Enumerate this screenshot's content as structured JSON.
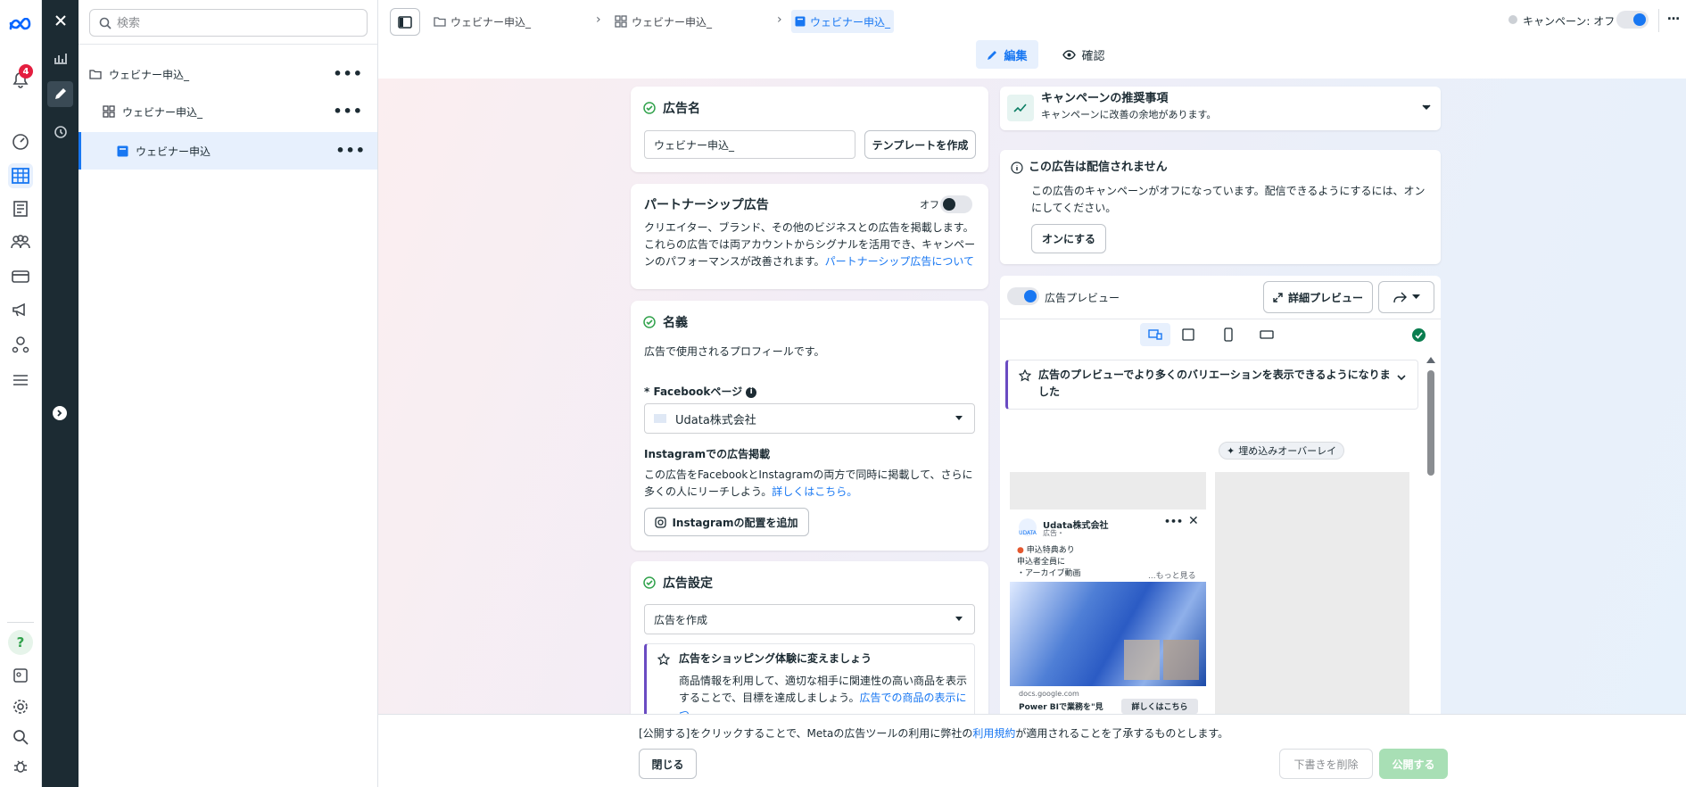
{
  "rail": {
    "notif_count": "4"
  },
  "tree": {
    "search_placeholder": "検索",
    "items": [
      {
        "label": "ウェビナー申込_"
      },
      {
        "label": "ウェビナー申込_"
      },
      {
        "label": "ウェビナー申込"
      }
    ]
  },
  "breadcrumb": {
    "campaign": "ウェビナー申込_",
    "adset": "ウェビナー申込_",
    "ad": "ウェビナー申込_"
  },
  "header": {
    "campaign_status": "キャンペーン: オフ",
    "tab_edit": "編集",
    "tab_review": "確認"
  },
  "ad_name_card": {
    "title": "広告名",
    "value": "ウェビナー申込_",
    "template_button": "テンプレートを作成"
  },
  "partnership_card": {
    "title": "パートナーシップ広告",
    "toggle_label": "オフ",
    "description": "クリエイター、ブランド、その他のビジネスとの広告を掲載します。これらの広告では両アカウントからシグナルを活用でき、キャンペーンのパフォーマンスが改善されます。",
    "link": "パートナーシップ広告について"
  },
  "identity_card": {
    "title": "名義",
    "subtitle": "広告で使用されるプロフィールです。",
    "fb_page_label": "* Facebookページ",
    "fb_page_value": "Udata株式会社",
    "instagram_heading": "Instagramでの広告掲載",
    "instagram_desc": "この広告をFacebookとInstagramの両方で同時に掲載して、さらに多くの人にリーチしよう。",
    "instagram_link": "詳しくはこちら。",
    "instagram_button": "Instagramの配置を追加"
  },
  "ad_setup_card": {
    "title": "広告設定",
    "select_value": "広告を作成",
    "tip_title": "広告をショッピング体験に変えましょう",
    "tip_desc": "商品情報を利用して、適切な相手に関連性の高い商品を表示することで、目標を達成しましょう。",
    "tip_link": "広告での商品の表示につ"
  },
  "recommendations": {
    "title": "キャンペーンの推奨事項",
    "subtitle": "キャンペーンに改善の余地があります。"
  },
  "delivery_notice": {
    "title": "この広告は配信されません",
    "desc": "この広告のキャンペーンがオフになっています。配信できるようにするには、オンにしてください。",
    "button": "オンにする"
  },
  "preview": {
    "label": "広告プレビュー",
    "detail_button": "詳細プレビュー",
    "banner": "広告のプレビューでより多くのバリエーションを表示できるようになりました",
    "overlay_badge": "埋め込みオーバーレイ",
    "post": {
      "page_name": "Udata株式会社",
      "sponsored": "広告・",
      "logo_text": "UDATA",
      "line1": "申込特典あり",
      "line2": "申込者全員に",
      "line3": "・アーカイブ動画",
      "more": "...もっと見る",
      "domain": "docs.google.com",
      "headline": "Power BIで業務を\"見",
      "cta": "詳しくはこちら"
    }
  },
  "footer": {
    "notice_prefix": "[公開する]をクリックすることで、Metaの広告ツールの利用に弊社の",
    "notice_link": "利用規約",
    "notice_suffix": "が適用されることを了承するものとします。",
    "close": "閉じる",
    "delete_draft": "下書きを削除",
    "publish": "公開する"
  },
  "colors": {
    "accent": "#1877f2",
    "sidebar_dark": "#1c2b33",
    "success": "#31a24c",
    "publish_disabled": "#a8dfb5"
  }
}
